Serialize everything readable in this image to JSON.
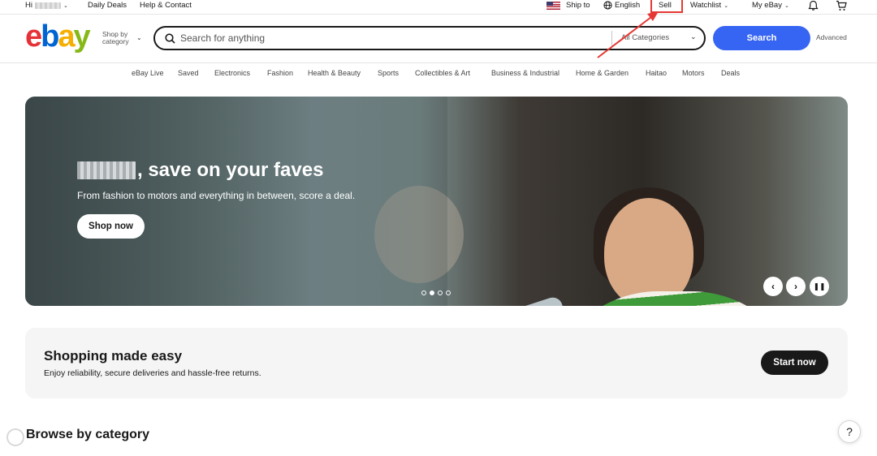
{
  "topbar": {
    "greeting": "Hi",
    "daily_deals": "Daily Deals",
    "help_contact": "Help & Contact",
    "ship_to": "Ship to",
    "language": "English",
    "sell": "Sell",
    "watchlist": "Watchlist",
    "my_ebay": "My eBay"
  },
  "header": {
    "logo": "ebay",
    "shop_by_line1": "Shop by",
    "shop_by_line2": "category",
    "search_placeholder": "Search for anything",
    "category_select": "All Categories",
    "search_button": "Search",
    "advanced": "Advanced"
  },
  "category_nav": [
    "eBay Live",
    "Saved",
    "Electronics",
    "Fashion",
    "Health & Beauty",
    "Sports",
    "Collectibles & Art",
    "Business & Industrial",
    "Home & Garden",
    "Haitao",
    "Motors",
    "Deals"
  ],
  "hero": {
    "title_suffix": ", save on your faves",
    "subtitle": "From fashion to motors and everything in between, score a deal.",
    "cta": "Shop now",
    "slide_count": 4,
    "active_slide": 2
  },
  "promo": {
    "title": "Shopping made easy",
    "subtitle": "Enjoy reliability, secure deliveries and hassle-free returns.",
    "cta": "Start now"
  },
  "browse_title": "Browse by category",
  "help_label": "?",
  "colors": {
    "ebay_red": "#e53238",
    "ebay_blue": "#0064d2",
    "ebay_yellow": "#f5af02",
    "ebay_green": "#86b817",
    "search_button": "#3665f3",
    "annotation_red": "#e53935"
  }
}
